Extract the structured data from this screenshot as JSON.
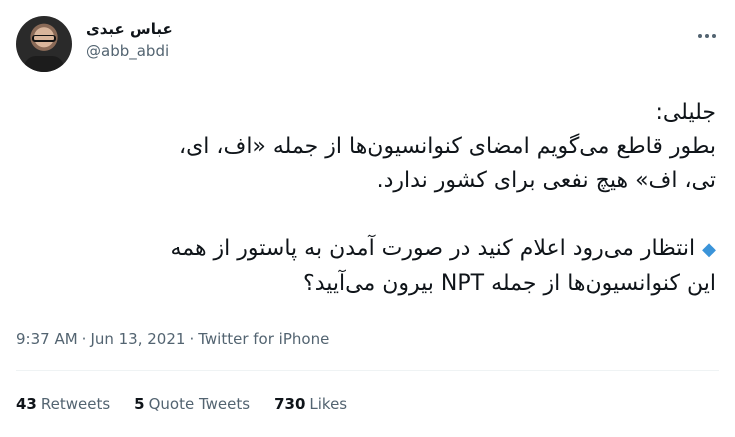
{
  "user": {
    "display_name": "عباس عبدی",
    "handle": "@abb_abdi"
  },
  "tweet": {
    "line1": "جلیلی:",
    "line2": "بطور قاطع می‌گویم امضای کنوانسیون‌ها از جمله «اف، ای،",
    "line3": "تی، اف» هیچ نفعی برای کشور ندارد.",
    "line4": "انتظار می‌رود اعلام کنید در صورت آمدن به پاستور از همه",
    "line5": "این کنوانسیون‌ها از جمله NPT بیرون می‌آیید؟"
  },
  "meta": {
    "time": "9:37 AM",
    "date": "Jun 13, 2021",
    "source": "Twitter for iPhone",
    "separator": "·"
  },
  "stats": {
    "retweets_count": "43",
    "retweets_label": "Retweets",
    "quotes_count": "5",
    "quotes_label": "Quote Tweets",
    "likes_count": "730",
    "likes_label": "Likes"
  },
  "icons": {
    "bullet": "small-blue-diamond",
    "more": "more-horizontal-icon"
  }
}
